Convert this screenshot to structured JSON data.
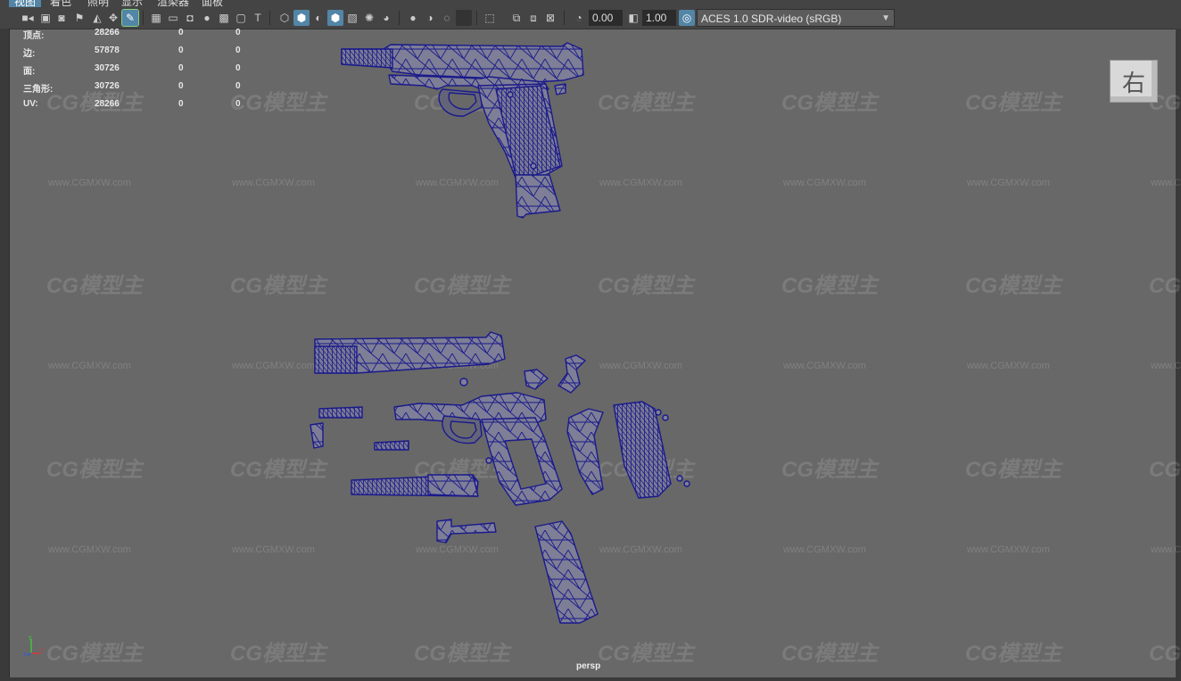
{
  "menu": {
    "items": [
      {
        "label": "视图",
        "active": true
      },
      {
        "label": "着色",
        "active": false
      },
      {
        "label": "照明",
        "active": false
      },
      {
        "label": "显示",
        "active": false
      },
      {
        "label": "渲染器",
        "active": false
      },
      {
        "label": "面板",
        "active": false
      }
    ]
  },
  "toolbar": {
    "exposure_value": "0.00",
    "gamma_value": "1.00",
    "color_space": "ACES 1.0 SDR-video (sRGB)"
  },
  "hud": {
    "rows": [
      {
        "label": "顶点:",
        "value": "28266",
        "col2": "0",
        "col3": "0"
      },
      {
        "label": "边:",
        "value": "57878",
        "col2": "0",
        "col3": "0"
      },
      {
        "label": "面:",
        "value": "30726",
        "col2": "0",
        "col3": "0"
      },
      {
        "label": "三角形:",
        "value": "30726",
        "col2": "0",
        "col3": "0"
      },
      {
        "label": "UV:",
        "value": "28266",
        "col2": "0",
        "col3": "0"
      }
    ]
  },
  "viewcube": {
    "face_label": "右"
  },
  "camera": {
    "name": "persp"
  },
  "axis": {
    "x": "x",
    "y": "y",
    "z": "z"
  },
  "watermark": {
    "logo": "CG模型主",
    "url": "www.CGMXW.com"
  },
  "colors": {
    "viewport_bg": "#686868",
    "wire": "#1a1a8c",
    "mesh_fill": "#7e7e96",
    "active_blue": "#5285a6"
  }
}
